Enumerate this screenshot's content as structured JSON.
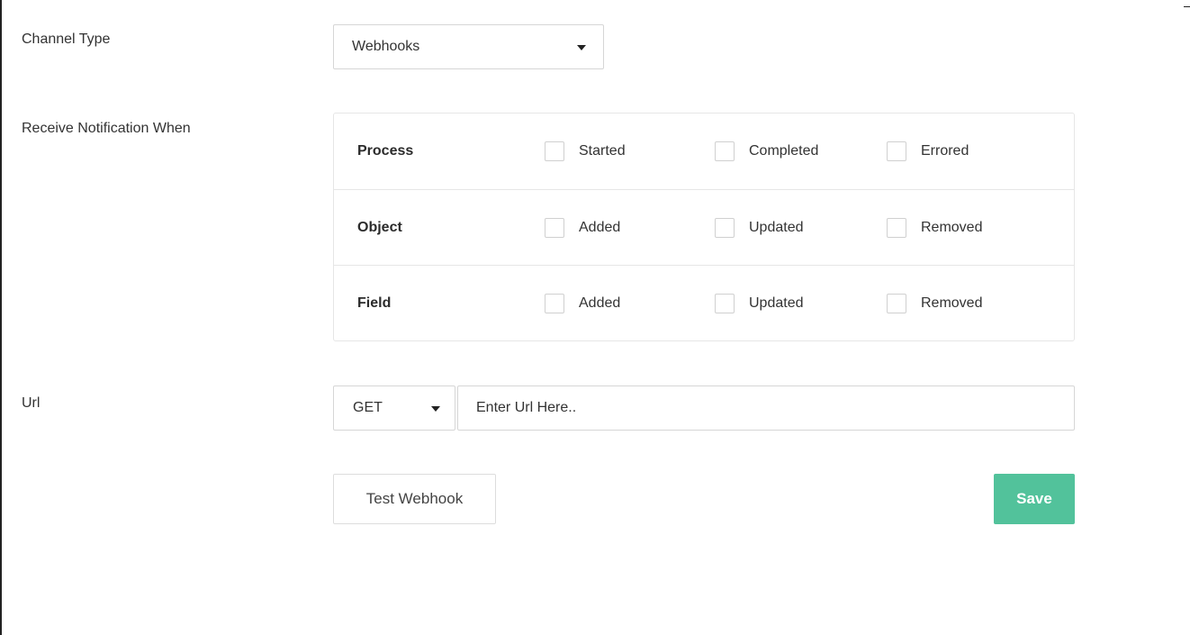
{
  "form": {
    "channel_type": {
      "label": "Channel Type",
      "selected": "Webhooks"
    },
    "notifications": {
      "label": "Receive Notification When",
      "rows": [
        {
          "name": "Process",
          "options": [
            "Started",
            "Completed",
            "Errored"
          ]
        },
        {
          "name": "Object",
          "options": [
            "Added",
            "Updated",
            "Removed"
          ]
        },
        {
          "name": "Field",
          "options": [
            "Added",
            "Updated",
            "Removed"
          ]
        }
      ]
    },
    "url": {
      "label": "Url",
      "method": "GET",
      "placeholder": "Enter Url Here..",
      "value": ""
    },
    "buttons": {
      "test": "Test Webhook",
      "save": "Save"
    }
  },
  "colors": {
    "save_button": "#52c29b",
    "border": "#d6d6d6"
  }
}
